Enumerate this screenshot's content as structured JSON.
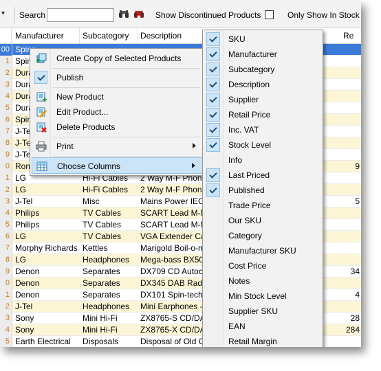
{
  "toolbar": {
    "search_label": "Search",
    "search_value": "",
    "discontinued_label": "Show Discontinued Products",
    "only_show_label": "Only Show In Stock"
  },
  "grid": {
    "headers": [
      "Manufacturer",
      "Subcategory",
      "Description",
      "Re"
    ],
    "rows": [
      {
        "n": "00",
        "m": "Spinn",
        "s": "",
        "d": "",
        "r": "",
        "style": "sel"
      },
      {
        "n": "1",
        "m": "Spinn",
        "s": "",
        "d": "",
        "r": "",
        "style": "w"
      },
      {
        "n": "2",
        "m": "Dura",
        "s": "",
        "d": "",
        "r": "",
        "style": "y"
      },
      {
        "n": "3",
        "m": "Dura",
        "s": "",
        "d": "",
        "r": "",
        "style": "w"
      },
      {
        "n": "4",
        "m": "Dura",
        "s": "",
        "d": "",
        "r": "",
        "style": "y"
      },
      {
        "n": "5",
        "m": "Dura",
        "s": "",
        "d": "",
        "r": "",
        "style": "w"
      },
      {
        "n": "6",
        "m": "Spinn",
        "s": "",
        "d": "",
        "r": "",
        "style": "y"
      },
      {
        "n": "7",
        "m": "J-Tel",
        "s": "",
        "d": "",
        "r": "",
        "style": "w"
      },
      {
        "n": "8",
        "m": "J-Tel",
        "s": "",
        "d": "",
        "r": "",
        "style": "y"
      },
      {
        "n": "9",
        "m": "J-Tel",
        "s": "",
        "d": "",
        "r": "",
        "style": "w"
      },
      {
        "n": "0",
        "m": "Ronco",
        "s": "",
        "d": "",
        "r": "9",
        "style": "y"
      },
      {
        "n": "1",
        "m": "LG",
        "s": "Hi-Fi Cables",
        "d": "2 Way M-F Phono",
        "r": "",
        "style": "w"
      },
      {
        "n": "2",
        "m": "LG",
        "s": "Hi-Fi Cables",
        "d": "2 Way M-F Phono",
        "r": "",
        "style": "y"
      },
      {
        "n": "3",
        "m": "J-Tel",
        "s": "Misc",
        "d": "Mains Power IEC L",
        "r": "5",
        "style": "w"
      },
      {
        "n": "4",
        "m": "Philips",
        "s": "TV Cables",
        "d": "SCART Lead M-M",
        "r": "",
        "style": "y"
      },
      {
        "n": "5",
        "m": "Philips",
        "s": "TV Cables",
        "d": "SCART Lead M-M",
        "r": "",
        "style": "w"
      },
      {
        "n": "6",
        "m": "LG",
        "s": "TV Cables",
        "d": "VGA Extender Cabl",
        "r": "",
        "style": "y"
      },
      {
        "n": "7",
        "m": "Morphy Richards",
        "s": "Kettles",
        "d": "Marigold Boil-o-mati",
        "r": "",
        "style": "w"
      },
      {
        "n": "8",
        "m": "LG",
        "s": "Headphones",
        "d": "Mega-bass BX501",
        "r": "",
        "style": "y"
      },
      {
        "n": "9",
        "m": "Denon",
        "s": "Separates",
        "d": "DX709 CD Autocha",
        "r": "34",
        "style": "w"
      },
      {
        "n": "0",
        "m": "Denon",
        "s": "Separates",
        "d": "DX345 DAB Radio",
        "r": "",
        "style": "y"
      },
      {
        "n": "1",
        "m": "Denon",
        "s": "Separates",
        "d": "DX101 Spin-tech P",
        "r": "4",
        "style": "w"
      },
      {
        "n": "2",
        "m": "J-Tel",
        "s": "Headphones",
        "d": "Mini Earphones - B",
        "r": "",
        "style": "y"
      },
      {
        "n": "3",
        "m": "Sony",
        "s": "Mini Hi-Fi",
        "d": "ZX8765-S CD/DAB",
        "r": "28",
        "style": "w"
      },
      {
        "n": "4",
        "m": "Sony",
        "s": "Mini Hi-Fi",
        "d": "ZX8765-X CD/DAB",
        "r": "284",
        "style": "y"
      },
      {
        "n": "5",
        "m": "Earth Electrical",
        "s": "Disposals",
        "d": "Disposal of Old Co",
        "r": "",
        "style": "w"
      }
    ]
  },
  "context_menu": {
    "items": [
      {
        "label": "Create Copy of Selected Products",
        "icon": "copy-icon"
      },
      {
        "label": "Publish",
        "checked": true
      },
      {
        "label": "New Product",
        "icon": "new-product-icon"
      },
      {
        "label": "Edit Product...",
        "icon": "edit-icon"
      },
      {
        "label": "Delete Products",
        "icon": "delete-icon"
      },
      {
        "label": "Print",
        "icon": "printer-icon",
        "submenu": true
      },
      {
        "label": "Choose Columns",
        "icon": "columns-icon",
        "submenu": true
      }
    ]
  },
  "columns_menu": {
    "items": [
      {
        "label": "SKU",
        "checked": true
      },
      {
        "label": "Manufacturer",
        "checked": true
      },
      {
        "label": "Subcategory",
        "checked": true
      },
      {
        "label": "Description",
        "checked": true
      },
      {
        "label": "Supplier",
        "checked": true
      },
      {
        "label": "Retail Price",
        "checked": true
      },
      {
        "label": "Inc. VAT",
        "checked": true
      },
      {
        "label": "Stock Level",
        "checked": true
      },
      {
        "label": "Info",
        "checked": false
      },
      {
        "label": "Last Priced",
        "checked": true
      },
      {
        "label": "Published",
        "checked": true
      },
      {
        "label": "Trade Price",
        "checked": false
      },
      {
        "label": "Our SKU",
        "checked": false
      },
      {
        "label": "Category",
        "checked": false
      },
      {
        "label": "Manufacturer SKU",
        "checked": false
      },
      {
        "label": "Cost Price",
        "checked": false
      },
      {
        "label": "Notes",
        "checked": false
      },
      {
        "label": "Min Stock Level",
        "checked": false
      },
      {
        "label": "Supplier SKU",
        "checked": false
      },
      {
        "label": "EAN",
        "checked": false
      },
      {
        "label": "Retail Margin",
        "checked": false
      }
    ]
  },
  "colors": {
    "selection": "#3b7bd8",
    "row_alt": "#fdf6d6",
    "menu_highlight": "#cce4f7"
  }
}
